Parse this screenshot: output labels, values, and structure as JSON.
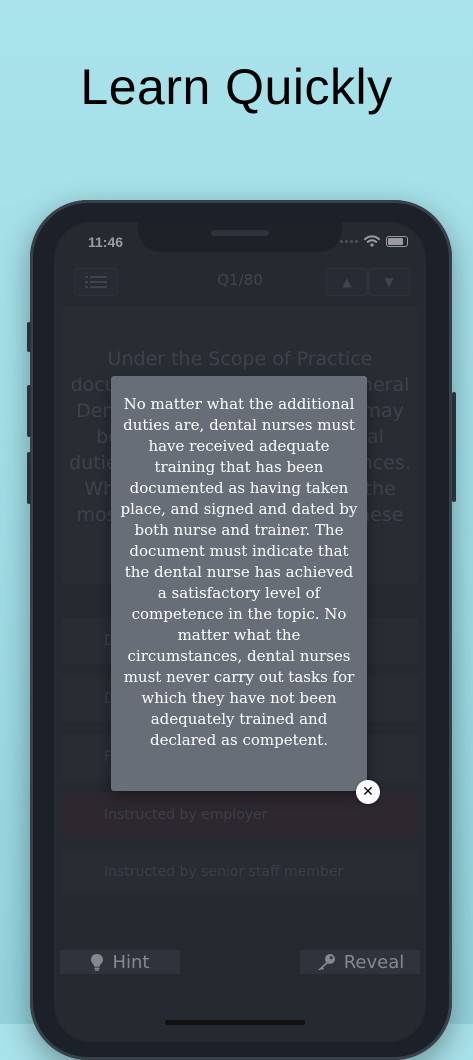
{
  "headline": "Learn Quickly",
  "status": {
    "time": "11:46"
  },
  "toolbar": {
    "menu_icon": "list-icon",
    "counter": "Q1/80",
    "up_icon": "triangle-up-icon",
    "down_icon": "triangle-down-icon"
  },
  "question": {
    "text": "Under the Scope of Practice document produced by the General Dental Council, dental nurses may be able to carry out additional duties under certain circumstances. Which one of the following is the most likely circumstance for these extra duties"
  },
  "answers": [
    {
      "label": "D"
    },
    {
      "label": "D"
    },
    {
      "label": "F"
    },
    {
      "label": "Instructed by employer",
      "state": "wrong"
    },
    {
      "label": "Instructed by senior staff member"
    }
  ],
  "explanation": {
    "text": "No matter what the additional duties are, dental nurses must have received adequate training that has been documented as having taken place, and signed and dated by both nurse and trainer. The document must indicate that the dental nurse has achieved a satisfactory level of competence in the topic. No matter what the circumstances, dental nurses must never carry out tasks for which they have not been adequately trained and declared as competent."
  },
  "bottom": {
    "hint_label": "Hint",
    "reveal_label": "Reveal"
  },
  "colors": {
    "background": "#9edbe4",
    "phone": "#1c2129",
    "screen": "#2b3038",
    "popup": "#686e78",
    "wrong_answer": "#3a2e35"
  }
}
